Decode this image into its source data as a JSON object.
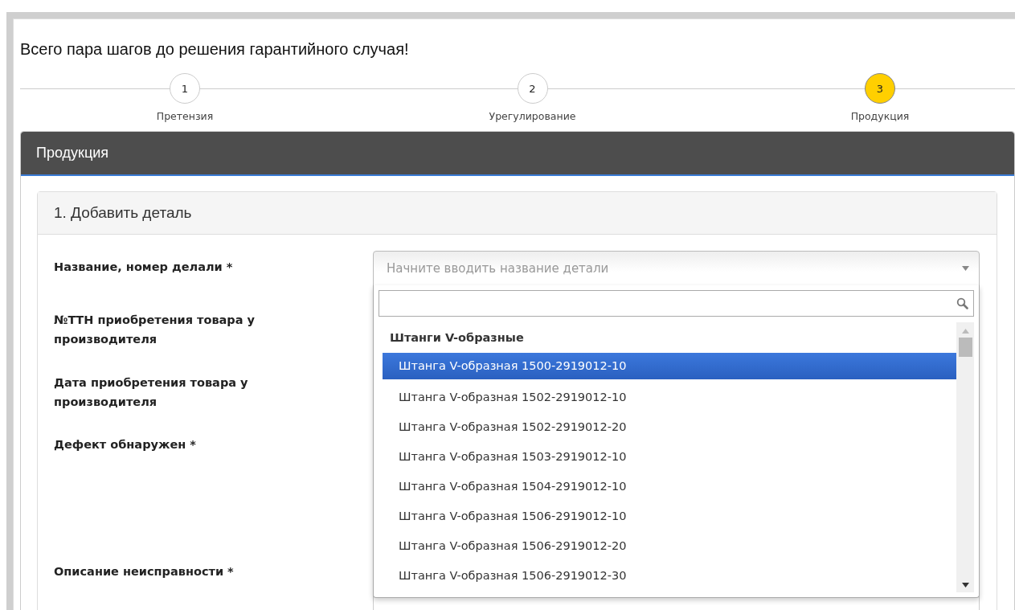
{
  "heading": "Всего пара шагов до решения гарантийного случая!",
  "steps": [
    {
      "number": "1",
      "label": "Претензия",
      "selected": false
    },
    {
      "number": "2",
      "label": "Урегулирование",
      "selected": false
    },
    {
      "number": "3",
      "label": "Продукция",
      "selected": true
    }
  ],
  "panel": {
    "title": "Продукция",
    "section": {
      "title": "1. Добавить деталь",
      "fields": [
        {
          "label": "Название, номер делали *"
        },
        {
          "label": "№ТТН приобретения товара у производителя"
        },
        {
          "label": "Дата приобретения товара у производителя"
        },
        {
          "label": "Дефект обнаружен *"
        },
        {
          "label": "Описание неисправности *"
        }
      ],
      "select": {
        "placeholder": "Начните вводить название детали",
        "expanded": true,
        "dropdown": {
          "group": "Штанги V-образные",
          "options": [
            {
              "label": "Штанга V-образная 1500-2919012-10",
              "selected": true
            },
            {
              "label": "Штанга V-образная 1502-2919012-10",
              "selected": false
            },
            {
              "label": "Штанга V-образная 1502-2919012-20",
              "selected": false
            },
            {
              "label": "Штанга V-образная 1503-2919012-10",
              "selected": false
            },
            {
              "label": "Штанга V-образная 1504-2919012-10",
              "selected": false
            },
            {
              "label": "Штанга V-образная 1506-2919012-10",
              "selected": false
            },
            {
              "label": "Штанга V-образная 1506-2919012-20",
              "selected": false
            },
            {
              "label": "Штанга V-образная 1506-2919012-30",
              "selected": false
            }
          ]
        }
      }
    }
  }
}
